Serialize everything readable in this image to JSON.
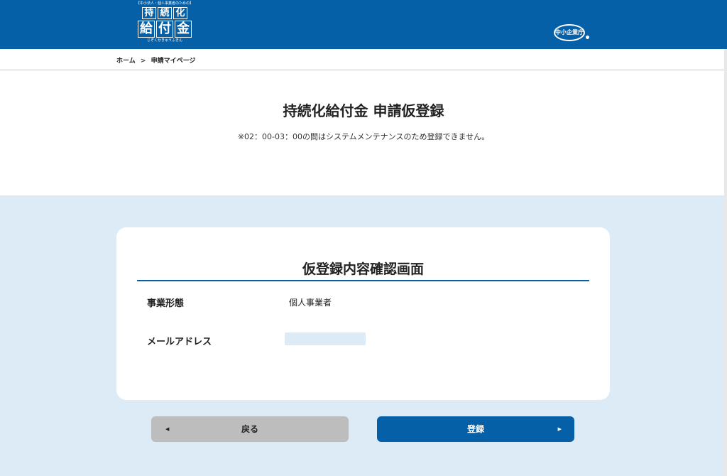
{
  "header": {
    "logo_tagline": "【中小法人・個人事業者のための】",
    "logo_line1": [
      "持",
      "続",
      "化"
    ],
    "logo_line2": [
      "給",
      "付",
      "金"
    ],
    "logo_reading": "じぞくかきゅうふきん",
    "agency_label": "中小企業庁"
  },
  "breadcrumb": {
    "home": "ホーム",
    "separator": ">",
    "current": "申請マイページ"
  },
  "page": {
    "title": "持続化給付金 申請仮登録",
    "notice": "※02：00-03：00の間はシステムメンテナンスのため登録できません。"
  },
  "card": {
    "title": "仮登録内容確認画面",
    "rows": [
      {
        "label": "事業形態",
        "value": "個人事業者"
      },
      {
        "label": "メールアドレス",
        "value": ""
      }
    ]
  },
  "buttons": {
    "back_label": "戻る",
    "back_arrow": "◀",
    "register_label": "登録",
    "register_arrow": "▶"
  },
  "colors": {
    "brand_blue": "#0560a8",
    "panel_bg": "#dcebf6",
    "back_button": "#bdbdbd"
  }
}
